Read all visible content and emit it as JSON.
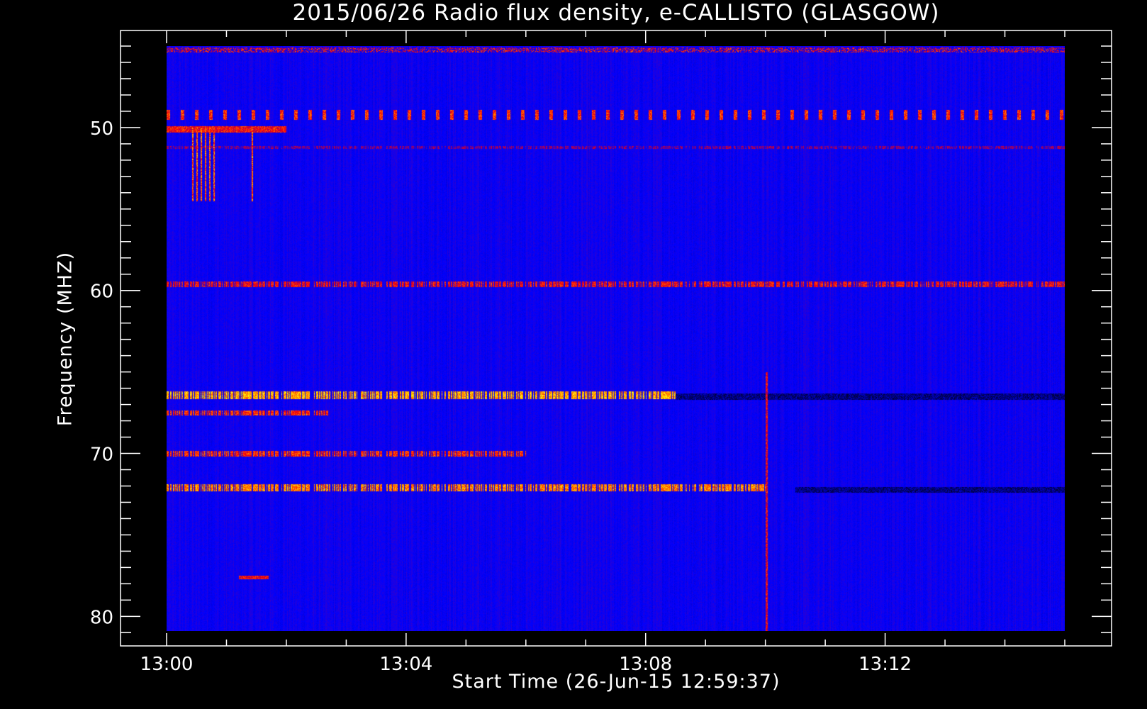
{
  "chart_data": {
    "type": "heatmap",
    "title": "2015/06/26  Radio flux density, e-CALLISTO (GLASGOW)",
    "xlabel": "Start Time (26-Jun-15 12:59:37)",
    "ylabel": "Frequency (MHZ)",
    "x_ticks": [
      "13:00",
      "13:04",
      "13:08",
      "13:12"
    ],
    "x_tick_minutes": [
      0,
      4,
      8,
      12
    ],
    "x_minor_step_minutes": 1,
    "xlim_minutes_after_13_00": [
      0,
      15
    ],
    "y_ticks": [
      50,
      60,
      70,
      80
    ],
    "y_minor_step": 1,
    "ylim": [
      45,
      80.9
    ],
    "y_inverted": true,
    "colormap": [
      "#000000",
      "#0000ff",
      "#ff0000",
      "#ff8000",
      "#ffff00",
      "#ffffff"
    ],
    "background_color": "#2a18ee",
    "features": [
      {
        "kind": "band",
        "freq": 45.2,
        "width": 0.3,
        "t": [
          0,
          15
        ],
        "intensity": 0.55,
        "pattern": "speckle"
      },
      {
        "kind": "band",
        "freq": 49.2,
        "width": 0.6,
        "t": [
          0,
          15
        ],
        "intensity": 0.6,
        "pattern": "periodic"
      },
      {
        "kind": "band",
        "freq": 50.1,
        "width": 0.4,
        "t": [
          0,
          2
        ],
        "intensity": 0.55,
        "pattern": "solid"
      },
      {
        "kind": "band",
        "freq": 51.2,
        "width": 0.2,
        "t": [
          0,
          15
        ],
        "intensity": 0.4,
        "pattern": "dashed"
      },
      {
        "kind": "band",
        "freq": 59.6,
        "width": 0.35,
        "t": [
          0,
          15
        ],
        "intensity": 0.55,
        "pattern": "dashed"
      },
      {
        "kind": "band",
        "freq": 66.4,
        "width": 0.5,
        "t": [
          0,
          8.5
        ],
        "intensity": 0.75,
        "pattern": "dashed"
      },
      {
        "kind": "band",
        "freq": 66.5,
        "width": 0.4,
        "t": [
          8.5,
          15
        ],
        "intensity": 0.0,
        "pattern": "dashed"
      },
      {
        "kind": "band",
        "freq": 67.5,
        "width": 0.3,
        "t": [
          0,
          2.7
        ],
        "intensity": 0.6,
        "pattern": "dashed"
      },
      {
        "kind": "band",
        "freq": 70.0,
        "width": 0.35,
        "t": [
          0,
          6
        ],
        "intensity": 0.6,
        "pattern": "dashed"
      },
      {
        "kind": "band",
        "freq": 72.1,
        "width": 0.45,
        "t": [
          0,
          10
        ],
        "intensity": 0.7,
        "pattern": "dashed"
      },
      {
        "kind": "band",
        "freq": 72.2,
        "width": 0.35,
        "t": [
          10.5,
          15
        ],
        "intensity": 0.0,
        "pattern": "dashed"
      },
      {
        "kind": "spot",
        "freq": 77.6,
        "width": 0.2,
        "t": [
          1.2,
          1.7
        ],
        "intensity": 0.55,
        "pattern": "solid"
      },
      {
        "kind": "burst",
        "freq_range": [
          50,
          54.5
        ],
        "t": [
          0.4,
          0.8
        ],
        "intensity": 0.85
      },
      {
        "kind": "burst",
        "freq_range": [
          50,
          54.5
        ],
        "t": [
          1.4,
          1.45
        ],
        "intensity": 0.85
      },
      {
        "kind": "line",
        "freq_range": [
          65,
          80.9
        ],
        "t": [
          10.0,
          10.03
        ],
        "intensity": 0.7
      }
    ]
  }
}
